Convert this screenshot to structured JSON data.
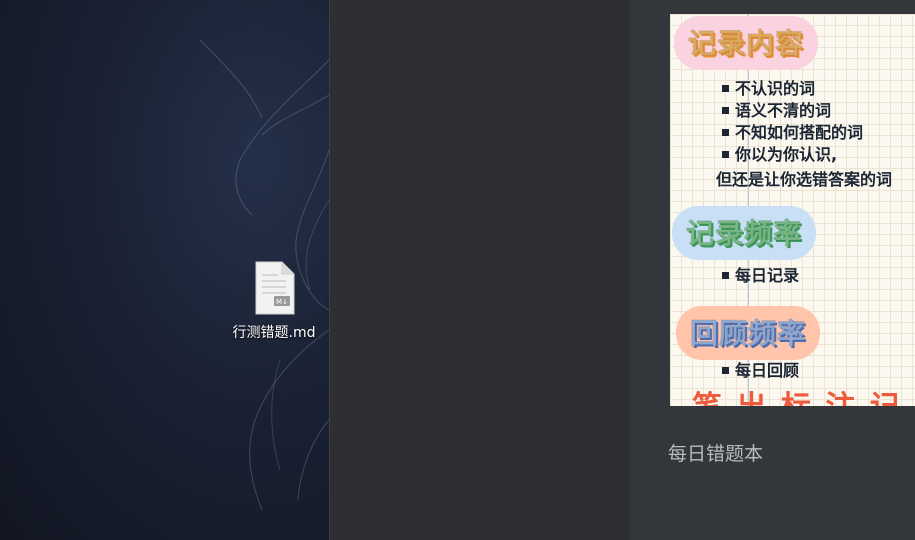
{
  "desktop": {
    "file": {
      "name": "行测错题.md",
      "icon": "markdown-file-icon",
      "badge": "M↓"
    }
  },
  "note": {
    "thumbnail": {
      "section1": {
        "heading": "记录内容",
        "items": [
          "不认识的词",
          "语义不清的词",
          "不知如何搭配的词",
          "你以为你认识,"
        ],
        "continuation": "但还是让你选错答案的词"
      },
      "section2": {
        "heading": "记录频率",
        "items": [
          "每日记录"
        ]
      },
      "section3": {
        "heading": "回顾频率",
        "items": [
          "每日回顾"
        ]
      },
      "cutoff_text": "笔 出 标 注 记"
    },
    "title": "每日错题本"
  },
  "colors": {
    "desktop_bg": "#1a2133",
    "middle_bg": "#2d2f33",
    "right_bg": "#33373b",
    "note_title": "#b8bbc0",
    "accent_red": "#ee5a3c"
  }
}
